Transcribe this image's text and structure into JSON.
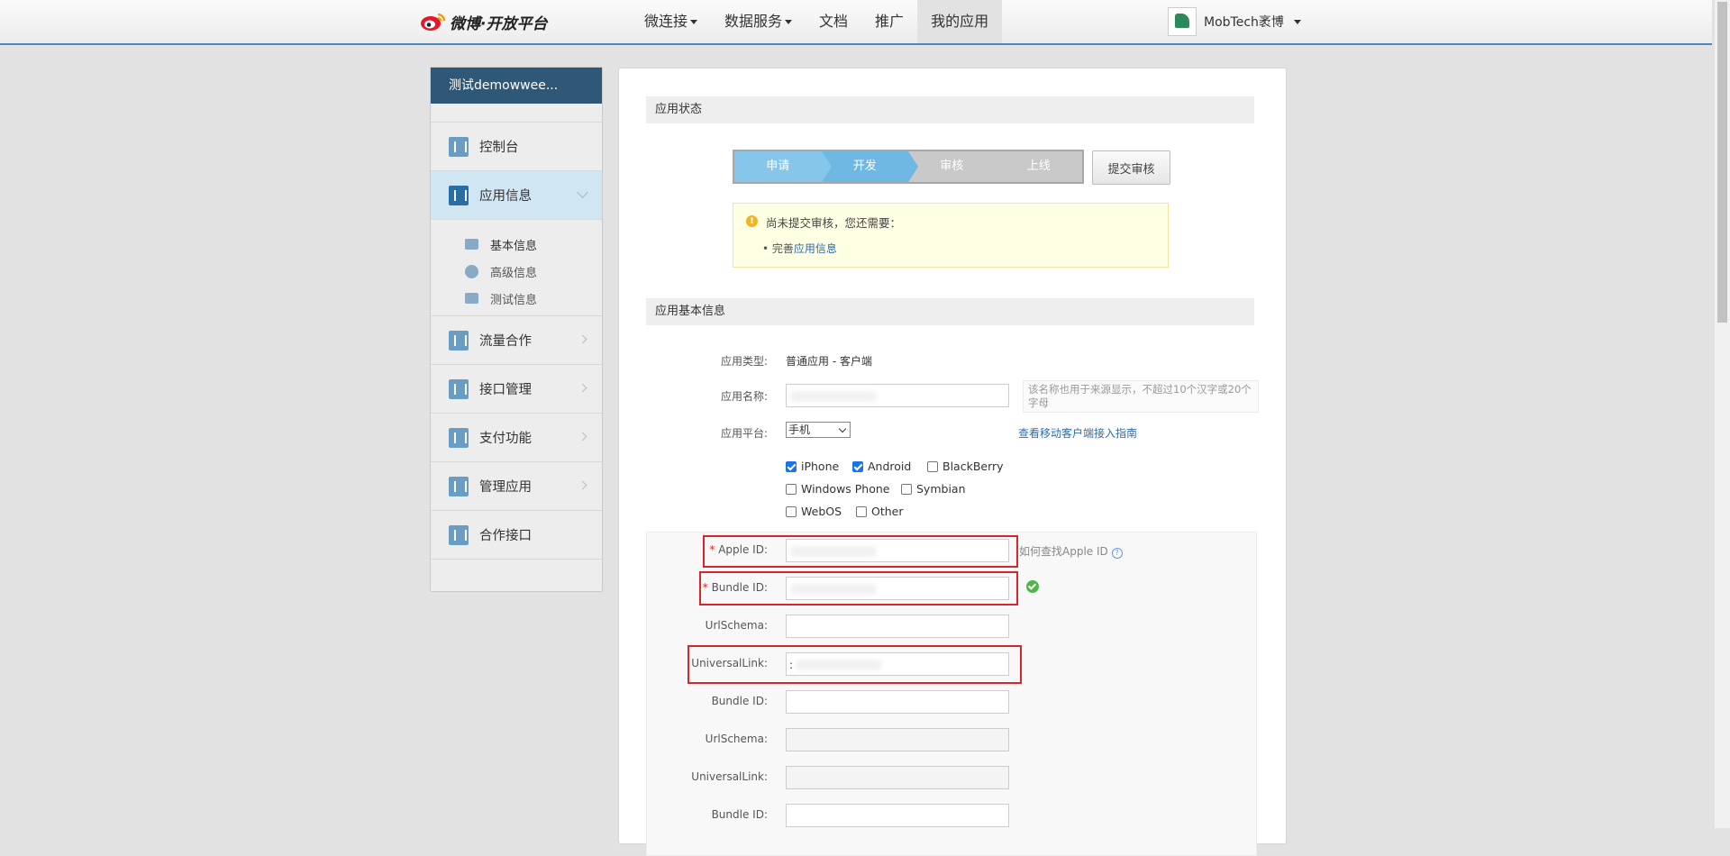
{
  "header": {
    "logo_text": "微博·开放平台",
    "nav": [
      {
        "label": "微连接",
        "has_caret": true
      },
      {
        "label": "数据服务",
        "has_caret": true
      },
      {
        "label": "文档",
        "has_caret": false
      },
      {
        "label": "推广",
        "has_caret": false
      },
      {
        "label": "我的应用",
        "has_caret": false,
        "active": true
      }
    ],
    "user_name": "MobTech袤博"
  },
  "sidebar": {
    "app_name": "测试demowwee...",
    "items": [
      {
        "label": "控制台",
        "icon": "sliders-icon"
      },
      {
        "label": "应用信息",
        "icon": "gear-icon",
        "active": true
      },
      {
        "label": "流量合作",
        "icon": "chart-icon"
      },
      {
        "label": "接口管理",
        "icon": "plug-icon"
      },
      {
        "label": "支付功能",
        "icon": "yen-icon"
      },
      {
        "label": "管理应用",
        "icon": "layers-icon"
      },
      {
        "label": "合作接口",
        "icon": "sliders-icon"
      }
    ],
    "sub_items": [
      {
        "label": "基本信息",
        "icon": "id-card-icon",
        "active": true
      },
      {
        "label": "高级信息",
        "icon": "info-icon"
      },
      {
        "label": "测试信息",
        "icon": "image-icon"
      }
    ]
  },
  "status": {
    "section_title": "应用状态",
    "steps": [
      "申请",
      "开发",
      "审核",
      "上线"
    ],
    "current_step": 2,
    "submit_label": "提交审核",
    "notice_title": "尚未提交审核，您还需要：",
    "notice_prefix": "完善",
    "notice_link": "应用信息"
  },
  "basic": {
    "section_title": "应用基本信息",
    "type_label": "应用类型:",
    "type_value": "普通应用 - 客户端",
    "name_label": "应用名称:",
    "name_hint": "该名称也用于来源显示，不超过10个汉字或20个字母",
    "platform_label": "应用平台:",
    "platform_value": "手机",
    "platform_link": "查看移动客户端接入指南",
    "platforms": [
      {
        "label": "iPhone",
        "checked": true
      },
      {
        "label": "Android",
        "checked": true
      },
      {
        "label": "BlackBerry",
        "checked": false
      },
      {
        "label": "Windows Phone",
        "checked": false
      },
      {
        "label": "Symbian",
        "checked": false
      },
      {
        "label": "WebOS",
        "checked": false
      },
      {
        "label": "Other",
        "checked": false
      }
    ]
  },
  "ios": {
    "apple_id_label": "Apple ID:",
    "apple_id_help": "如何查找Apple ID",
    "bundle_id_label": "Bundle ID:",
    "urlschema_label": "UrlSchema:",
    "universal_link_label": "UniversalLink:",
    "universal_link_prefix": ":",
    "required_mark": "*"
  }
}
